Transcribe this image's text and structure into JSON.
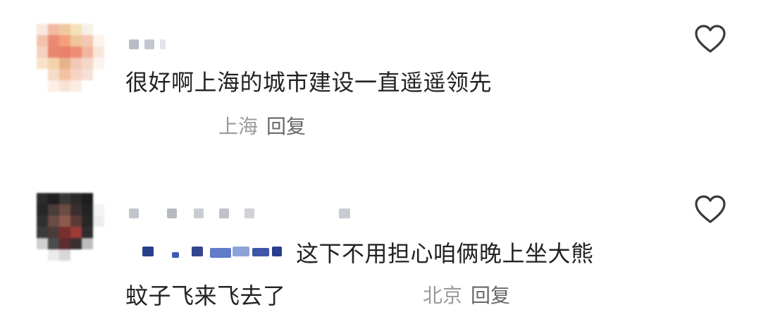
{
  "comments": [
    {
      "text": "很好啊上海的城市建设一直遥遥领先",
      "location": "上海",
      "reply_label": "回复",
      "like_icon": "heart-outline-icon"
    },
    {
      "text_line1": "这下不用担心咱俩晚上坐大熊",
      "text_line2": "蚊子飞来飞去了",
      "location": "北京",
      "reply_label": "回复",
      "like_icon": "heart-outline-icon"
    }
  ]
}
